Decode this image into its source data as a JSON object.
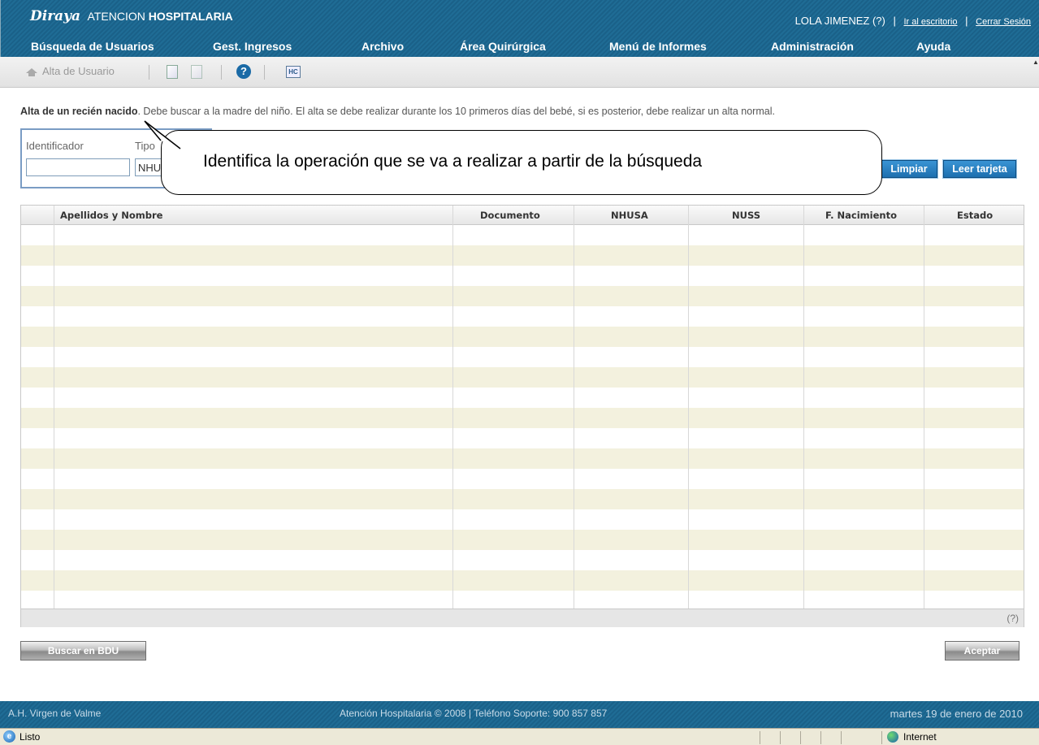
{
  "header": {
    "logo": "Diraya",
    "app_prefix": "ATENCION",
    "app_bold": "HOSPITALARIA",
    "user": "LOLA JIMENEZ (?)",
    "desktop_link": "Ir al escritorio",
    "logout_link": "Cerrar Sesión",
    "separator": "|"
  },
  "nav": [
    "Búsqueda de Usuarios",
    "Gest. Ingresos",
    "Archivo",
    "Área Quirúrgica",
    "Menú de Informes",
    "Administración",
    "Ayuda"
  ],
  "toolbar": {
    "add_user": "Alta de Usuario",
    "hc_label": "HC",
    "help_label": "?"
  },
  "info": {
    "title": "Alta de un recién nacido",
    "text": ". Debe buscar a la madre del niño. El alta se debe realizar durante los 10 primeros días del bebé, si es posterior, debe realizar un alta normal."
  },
  "search": {
    "identifier_label": "Identificador",
    "identifier_value": "",
    "type_label": "Tipo",
    "type_value": "NHU",
    "clear_button": "Limpiar",
    "read_card_button": "Leer tarjeta"
  },
  "callout": "Identifica la operación que se va a realizar a partir de la búsqueda",
  "grid": {
    "columns": [
      "",
      "Apellidos y Nombre",
      "Documento",
      "NHUSA",
      "NUSS",
      "F. Nacimiento",
      "Estado"
    ],
    "rows": [],
    "help": "(?)"
  },
  "actions": {
    "search_bdu": "Buscar en BDU",
    "accept": "Aceptar"
  },
  "footer": {
    "center": "A.H. Virgen de Valme",
    "copyright": "Atención Hospitalaria © 2008 | Teléfono Soporte: 900 857 857",
    "date": "martes 19 de enero de 2010"
  },
  "status": {
    "text": "Listo",
    "zone": "Internet"
  },
  "colors": {
    "header_bg": "#1f6c95",
    "row_alt": "#f3f1de",
    "button_blue": "#1d6faf"
  }
}
